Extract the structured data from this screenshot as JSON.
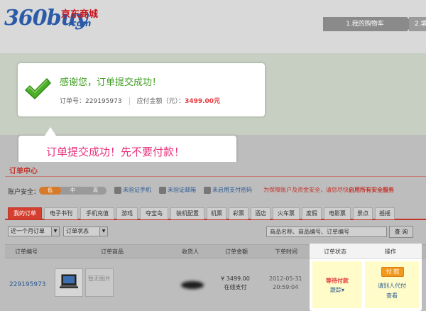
{
  "logo": {
    "number_text": "360buy",
    "domain_text": ".com",
    "cn_text": "京东商城"
  },
  "steps": [
    {
      "label": "1.我的购物车"
    },
    {
      "label": "2.填"
    }
  ],
  "success": {
    "title": "感谢您，订单提交成功！",
    "order_label": "订单号：",
    "order_number": "229195973",
    "amount_label": "应付金额（元）：",
    "amount": "3499.00元"
  },
  "callout": {
    "text": "订单提交成功！先不要付款！"
  },
  "user_center": {
    "title": "订单中心",
    "security": {
      "label": "账户安全：",
      "level_fraction": 0.33,
      "segments": [
        "低",
        "中",
        "高"
      ],
      "links": [
        "未验证手机",
        "未验证邮箱",
        "未启用支付密码"
      ],
      "warning_prefix": "为保障账户及资金安全，请您尽快",
      "warning_bold": "启用所有安全服务"
    },
    "tabs": [
      "我的订单",
      "电子书刊",
      "手机充值",
      "游戏",
      "夺宝岛",
      "装机配置",
      "机票",
      "彩票",
      "酒店",
      "火车票",
      "度假",
      "电影票",
      "景点",
      "摇摇"
    ],
    "filters": {
      "range": "近一个月订单",
      "status": "订单状态",
      "search_placeholder": "商品名称、商品编号、订单编号",
      "search_button": "查 询"
    },
    "table": {
      "headers": [
        "订单编号",
        "订单商品",
        "收货人",
        "订单金额",
        "下单时间",
        "订单状态",
        "操作"
      ],
      "row": {
        "order_id": "229195973",
        "no_image_text": "暂无图片",
        "amount": "¥ 3499.00",
        "payment": "在线支付",
        "date": "2012-05-31",
        "time": "20:59:04",
        "status": "等待付款",
        "track": "跟踪▾",
        "pay_button": "付 款",
        "proxy_pay": "请别人代付",
        "view": "查看"
      }
    }
  },
  "colors": {
    "brand_red": "#e4393c",
    "success_green": "#3d9d1f",
    "callout_pink": "#e8317c",
    "link_blue": "#2b5a94",
    "pay_orange": "#f29a1f"
  }
}
